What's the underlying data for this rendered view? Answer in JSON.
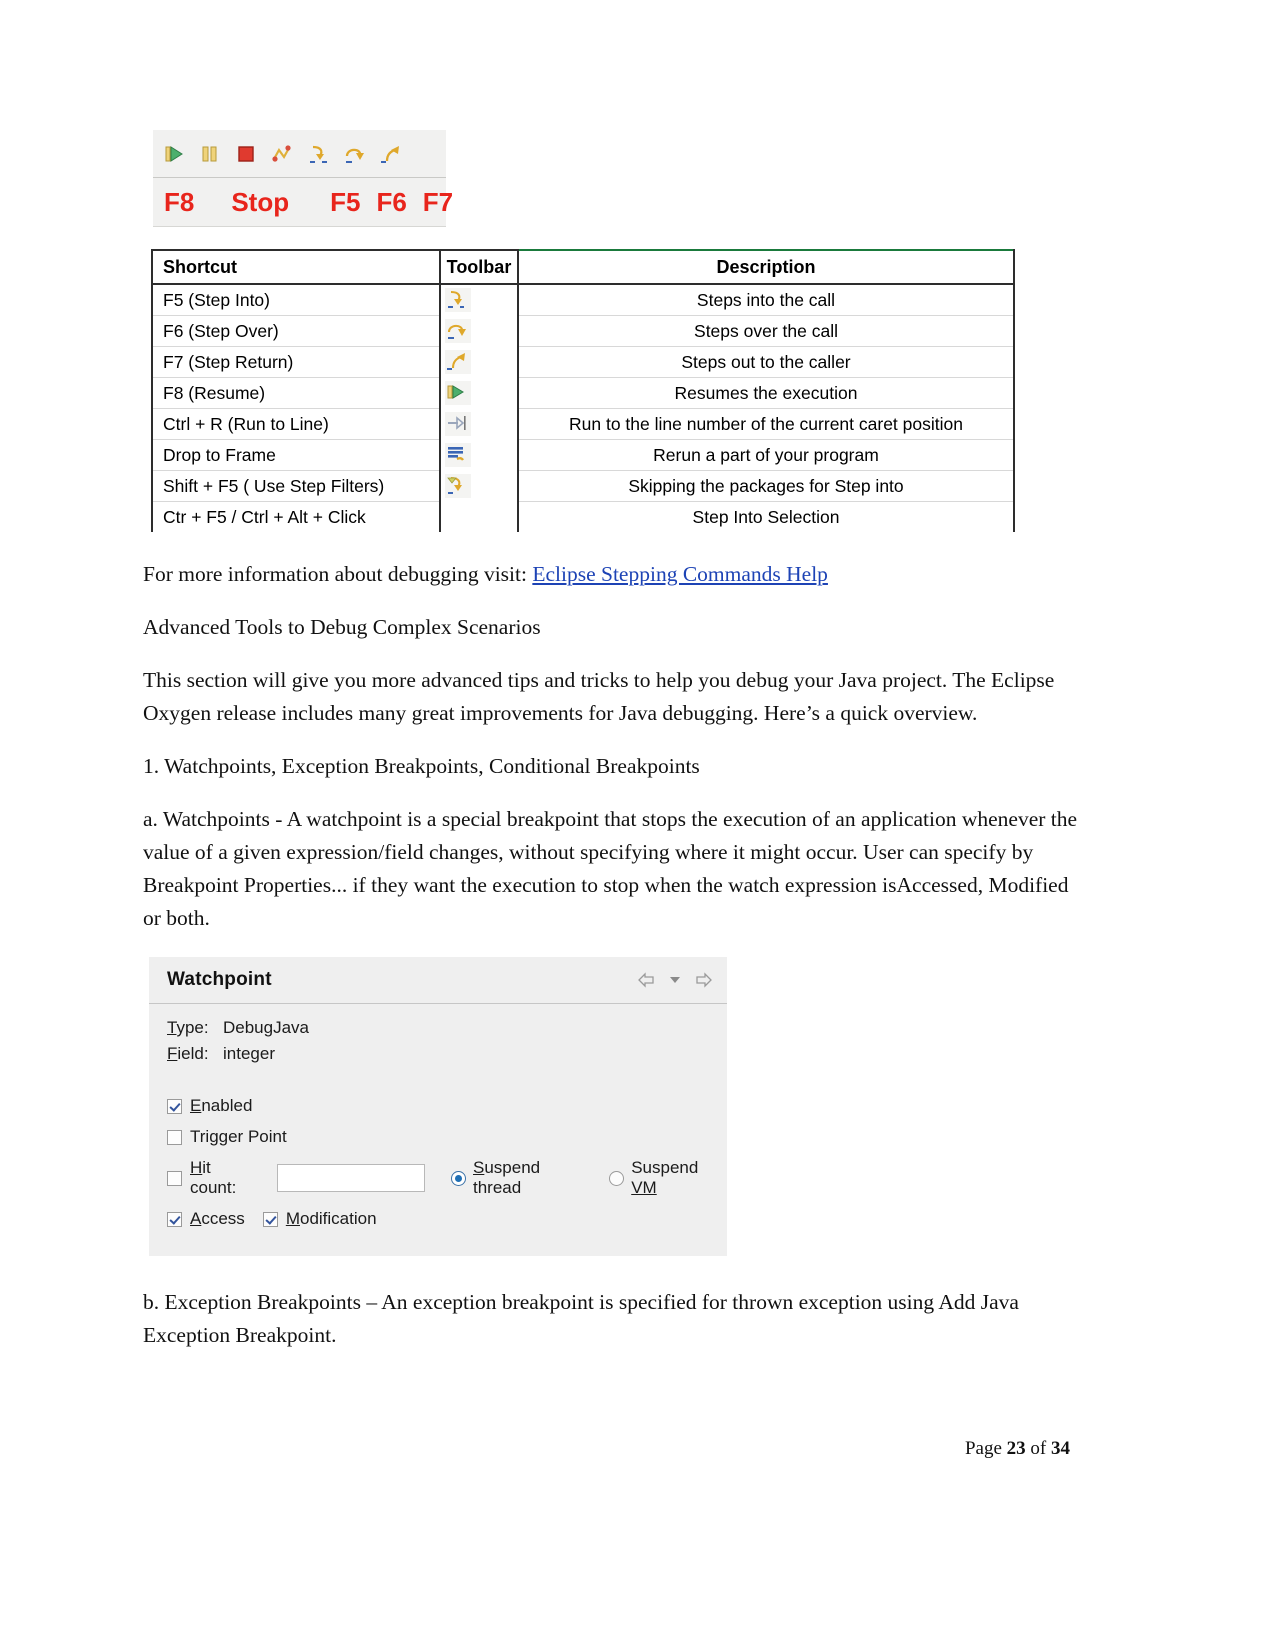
{
  "document": {
    "toolbar_figure": {
      "icons": [
        {
          "name": "resume-icon",
          "title": "Resume"
        },
        {
          "name": "suspend-icon",
          "title": "Suspend"
        },
        {
          "name": "terminate-icon",
          "title": "Terminate"
        },
        {
          "name": "disconnect-icon",
          "title": "Disconnect"
        },
        {
          "name": "step-into-icon",
          "title": "Step Into"
        },
        {
          "name": "step-over-icon",
          "title": "Step Over"
        },
        {
          "name": "step-return-icon",
          "title": "Step Return"
        }
      ],
      "keys": {
        "f8": "F8",
        "stop": "Stop",
        "f5": "F5",
        "f6": "F6",
        "f7": "F7"
      },
      "key_color": "#e8251c"
    },
    "shortcut_table": {
      "headers": [
        "Shortcut",
        "Toolbar",
        "Description"
      ],
      "rows": [
        {
          "shortcut": "F5  (Step Into)",
          "icon": "step-into-icon",
          "description": "Steps into the call"
        },
        {
          "shortcut": "F6 (Step Over)",
          "icon": "step-over-icon",
          "description": "Steps over the call"
        },
        {
          "shortcut": "F7 (Step Return)",
          "icon": "step-return-icon",
          "description": "Steps out to the caller"
        },
        {
          "shortcut": "F8 (Resume)",
          "icon": "resume-icon",
          "description": "Resumes the execution"
        },
        {
          "shortcut": "Ctrl + R (Run to Line)",
          "icon": "run-to-line-icon",
          "description": "Run to the line number of the current caret position"
        },
        {
          "shortcut": "Drop to Frame",
          "icon": "drop-to-frame-icon",
          "description": "Rerun a part of your program"
        },
        {
          "shortcut": "Shift + F5 ( Use Step Filters)",
          "icon": "step-filters-icon",
          "description": "Skipping the packages for Step into"
        },
        {
          "shortcut": "Ctr + F5 / Ctrl + Alt + Click",
          "icon": "",
          "description": "Step Into Selection"
        }
      ],
      "accent_color": "#1a7a3c"
    },
    "paragraphs": {
      "more_info_prefix": "For more information about debugging visit: ",
      "more_info_link": "Eclipse Stepping Commands Help",
      "advanced_tools_heading": "Advanced Tools to Debug Complex Scenarios",
      "intro": "This section will give you more advanced tips and tricks to help you debug your Java project. The Eclipse Oxygen release includes many great improvements for Java debugging. Here’s a quick overview.",
      "item_1": "1. Watchpoints, Exception Breakpoints, Conditional Breakpoints",
      "item_a": "a. Watchpoints - A watchpoint is a special breakpoint that stops the execution of an application whenever the value of a given expression/field changes, without specifying where it might occur. User can specify by Breakpoint Properties... if they want the execution to stop when the watch expression isAccessed, Modified or both.",
      "item_b": "b. Exception Breakpoints – An exception breakpoint is specified for thrown exception using Add Java Exception Breakpoint."
    },
    "watchpoint_dialog": {
      "title": "Watchpoint",
      "nav_back_icon": "back-arrow-icon",
      "nav_dropdown_icon": "chevron-down-icon",
      "nav_forward_icon": "forward-arrow-icon",
      "fields": [
        {
          "label_mnemonic": "T",
          "label_rest": "ype:",
          "value": "DebugJava"
        },
        {
          "label_mnemonic": "F",
          "label_rest": "ield:",
          "value": "integer"
        }
      ],
      "checkboxes": {
        "enabled": {
          "mnemonic": "E",
          "rest": "nabled",
          "checked": true
        },
        "trigger_point": {
          "mnemonic": "",
          "rest": "Trigger Point",
          "checked": false
        },
        "hit_count": {
          "mnemonic": "H",
          "rest": "it count:",
          "checked": false,
          "value": ""
        },
        "access": {
          "mnemonic": "A",
          "rest": "ccess",
          "checked": true
        },
        "modification": {
          "mnemonic": "M",
          "rest": "odification",
          "checked": true
        }
      },
      "radios": {
        "suspend_thread": {
          "mnemonic": "S",
          "rest": "uspend thread",
          "selected": true
        },
        "suspend_vm": {
          "prefix": "Suspend ",
          "mnemonic": "VM",
          "selected": false
        }
      }
    },
    "footer": {
      "label": "Page ",
      "current_page": "23",
      "of": " of ",
      "total_pages": "34"
    }
  }
}
